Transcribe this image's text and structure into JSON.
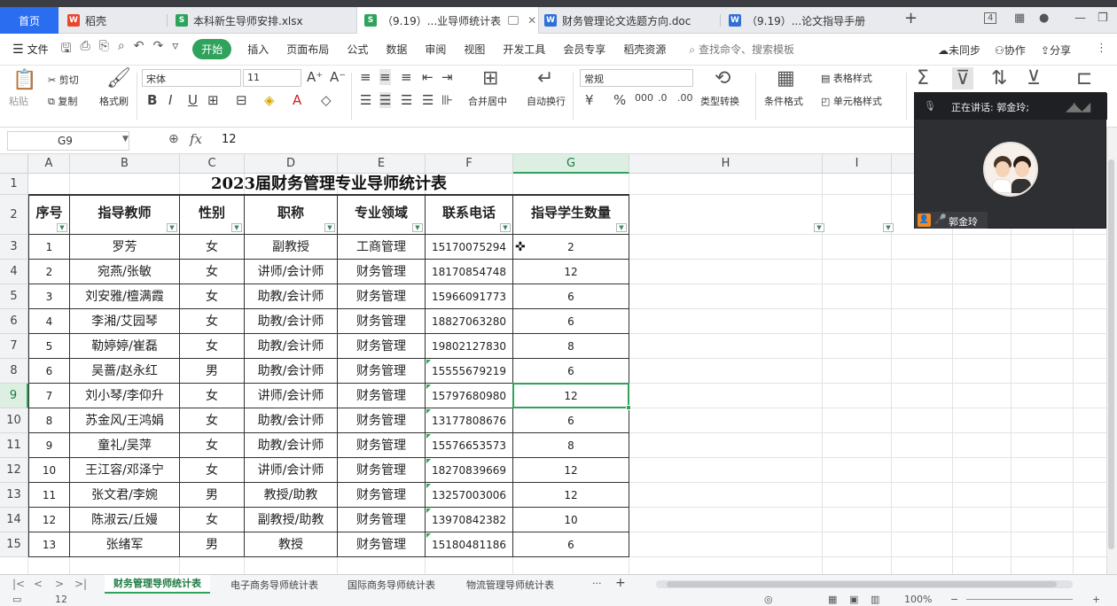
{
  "tabs": {
    "home": "首页",
    "items": [
      {
        "label": "稻壳",
        "icon": "wps-logo-icon"
      },
      {
        "label": "本科新生导师安排.xlsx",
        "icon": "spreadsheet-icon"
      },
      {
        "label": "（9.19）...业导师统计表",
        "icon": "spreadsheet-icon"
      },
      {
        "label": "财务管理论文选题方向.doc",
        "icon": "document-icon"
      },
      {
        "label": "（9.19）...论文指导手册",
        "icon": "document-icon"
      }
    ],
    "add": "+",
    "window_badge": "4"
  },
  "menubar": {
    "file": "文件",
    "items": [
      "开始",
      "插入",
      "页面布局",
      "公式",
      "数据",
      "审阅",
      "视图",
      "开发工具",
      "会员专享",
      "稻壳资源"
    ],
    "search": "查找命令、搜索模板",
    "sync": "未同步",
    "collab": "协作",
    "share": "分享"
  },
  "ribbon": {
    "paste": "粘贴",
    "cut": "剪切",
    "copy": "复制",
    "format_painter": "格式刷",
    "font_name": "宋体",
    "font_size": "11",
    "merge_center": "合并居中",
    "auto_wrap": "自动换行",
    "number_format": "常规",
    "type_convert": "类型转换",
    "conditional_format": "条件格式",
    "table_style": "表格样式",
    "cell_style": "单元格样式"
  },
  "formula": {
    "cell_ref": "G9",
    "fx": "fx",
    "value": "12"
  },
  "grid": {
    "columns": [
      "A",
      "B",
      "C",
      "D",
      "E",
      "F",
      "G",
      "H",
      "I"
    ],
    "rows": [
      "1",
      "2",
      "3",
      "4",
      "5",
      "6",
      "7",
      "8",
      "9",
      "10",
      "11",
      "12",
      "13",
      "14",
      "15"
    ],
    "title": "2023届财务管理专业导师统计表",
    "headers": [
      "序号",
      "指导教师",
      "性别",
      "职称",
      "专业领域",
      "联系电话",
      "指导学生数量"
    ],
    "data": [
      [
        "1",
        "罗芳",
        "女",
        "副教授",
        "工商管理",
        "15170075294",
        "2"
      ],
      [
        "2",
        "宛燕/张敏",
        "女",
        "讲师/会计师",
        "财务管理",
        "18170854748",
        "12"
      ],
      [
        "3",
        "刘安雅/檀满霞",
        "女",
        "助教/会计师",
        "财务管理",
        "15966091773",
        "6"
      ],
      [
        "4",
        "李湘/艾园琴",
        "女",
        "助教/会计师",
        "财务管理",
        "18827063280",
        "6"
      ],
      [
        "5",
        "勒婷婷/崔磊",
        "女",
        "助教/会计师",
        "财务管理",
        "19802127830",
        "8"
      ],
      [
        "6",
        "吴蔷/赵永红",
        "男",
        "助教/会计师",
        "财务管理",
        "15555679219",
        "6"
      ],
      [
        "7",
        "刘小琴/李仰升",
        "女",
        "讲师/会计师",
        "财务管理",
        "15797680980",
        "12"
      ],
      [
        "8",
        "苏金风/王鸿娟",
        "女",
        "助教/会计师",
        "财务管理",
        "13177808676",
        "6"
      ],
      [
        "9",
        "童礼/吴萍",
        "女",
        "助教/会计师",
        "财务管理",
        "15576653573",
        "8"
      ],
      [
        "10",
        "王江容/邓泽宁",
        "女",
        "讲师/会计师",
        "财务管理",
        "18270839669",
        "12"
      ],
      [
        "11",
        "张文君/李婉",
        "男",
        "教授/助教",
        "财务管理",
        "13257003006",
        "12"
      ],
      [
        "12",
        "陈淑云/丘嫚",
        "女",
        "副教授/助教",
        "财务管理",
        "13970842382",
        "10"
      ],
      [
        "13",
        "张绪军",
        "男",
        "教授",
        "财务管理",
        "15180481186",
        "6"
      ]
    ]
  },
  "sheets": {
    "tabs": [
      "财务管理导师统计表",
      "电子商务导师统计表",
      "国际商务导师统计表",
      "物流管理导师统计表"
    ],
    "active": "财务管理导师统计表",
    "more": "···",
    "add": "+"
  },
  "status": {
    "value": "12",
    "zoom": "100%"
  },
  "meeting": {
    "speaking": "正在讲话: 郭金玲;",
    "name": "郭金玲"
  }
}
